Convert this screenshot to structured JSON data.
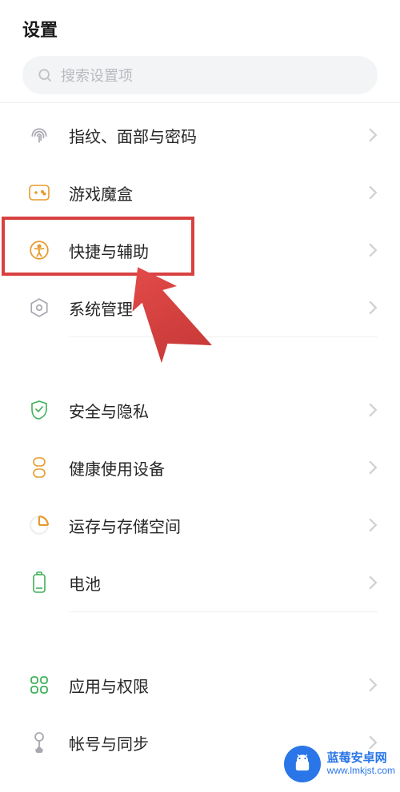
{
  "header": {
    "title": "设置"
  },
  "search": {
    "placeholder": "搜索设置项"
  },
  "groups": [
    [
      {
        "icon": "fingerprint",
        "label": "指纹、面部与密码"
      },
      {
        "icon": "gamebox",
        "label": "游戏魔盒"
      },
      {
        "icon": "accessibility",
        "label": "快捷与辅助"
      },
      {
        "icon": "system",
        "label": "系统管理"
      }
    ],
    [
      {
        "icon": "shield",
        "label": "安全与隐私"
      },
      {
        "icon": "hourglass",
        "label": "健康使用设备"
      },
      {
        "icon": "storage",
        "label": "运存与存储空间"
      },
      {
        "icon": "battery",
        "label": "电池"
      }
    ],
    [
      {
        "icon": "apps",
        "label": "应用与权限"
      },
      {
        "icon": "sync",
        "label": "帐号与同步"
      }
    ]
  ],
  "watermark": {
    "line1": "蓝莓安卓网",
    "line2": "www.lmkjst.com"
  },
  "colors": {
    "accent_blue": "#2a76e8",
    "highlight_red": "#d8413f",
    "icon_green": "#40b05a",
    "icon_orange": "#e89a2c",
    "icon_gray": "#a8a8b0"
  }
}
